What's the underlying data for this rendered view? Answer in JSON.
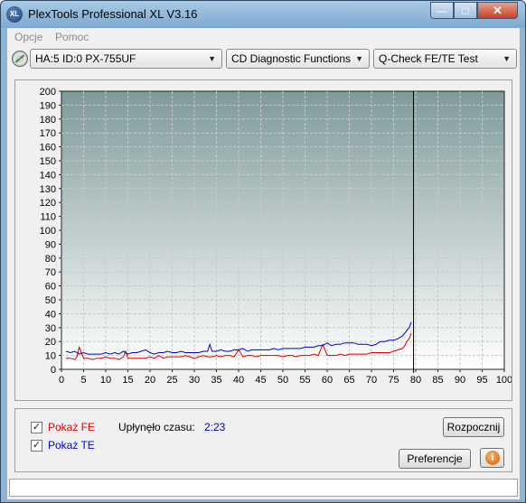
{
  "window": {
    "title": "PlexTools Professional XL V3.16",
    "icon_text": "XL",
    "minimize_symbol": "—",
    "maximize_symbol": "□",
    "close_symbol": "✕"
  },
  "menu": {
    "items": [
      "Opcje",
      "Pomoc"
    ]
  },
  "toolbar": {
    "drive": "HA:5 ID:0  PX-755UF",
    "function": "CD Diagnostic Functions",
    "test": "Q-Check FE/TE Test",
    "arrow_symbol": "▼"
  },
  "chart_data": {
    "type": "line",
    "xlim": [
      0,
      100
    ],
    "ylim": [
      0,
      200
    ],
    "xticks": [
      0,
      5,
      10,
      15,
      20,
      25,
      30,
      35,
      40,
      45,
      50,
      55,
      60,
      65,
      70,
      75,
      80,
      85,
      90,
      95,
      100
    ],
    "yticks": [
      0,
      10,
      20,
      30,
      40,
      50,
      60,
      70,
      80,
      90,
      100,
      110,
      120,
      130,
      140,
      150,
      160,
      170,
      180,
      190,
      200
    ],
    "grid": true,
    "marker_x": 79.5,
    "series": [
      {
        "name": "FE",
        "color": "#e00000",
        "x": [
          1,
          2,
          3,
          3.5,
          4,
          5,
          6,
          7,
          8,
          9,
          10,
          11,
          12,
          13,
          14,
          14.5,
          15,
          16,
          17,
          18,
          19,
          20,
          21,
          22,
          23,
          24,
          25,
          26,
          27,
          28,
          29,
          30,
          31,
          32,
          33,
          34,
          35,
          36,
          37,
          38,
          39,
          40,
          41,
          42,
          43,
          44,
          45,
          46,
          47,
          48,
          49,
          50,
          51,
          52,
          53,
          54,
          55,
          56,
          57,
          58,
          59,
          60,
          61,
          62,
          63,
          64,
          65,
          66,
          67,
          68,
          69,
          70,
          71,
          72,
          73,
          74,
          75,
          76,
          77,
          77.5,
          78,
          78.5,
          79
        ],
        "y": [
          8,
          8,
          7,
          9,
          16,
          8,
          8,
          7,
          8,
          8,
          9,
          8,
          8,
          7,
          9,
          13,
          8,
          8,
          8,
          8,
          8,
          9,
          8,
          10,
          8,
          9,
          9,
          9,
          9,
          10,
          9,
          8,
          9,
          10,
          9,
          9,
          10,
          9,
          10,
          10,
          9,
          14,
          9,
          10,
          10,
          9,
          10,
          10,
          10,
          10,
          10,
          9,
          10,
          10,
          9,
          10,
          10,
          10,
          11,
          10,
          18,
          10,
          10,
          10,
          11,
          10,
          11,
          11,
          11,
          11,
          11,
          12,
          12,
          12,
          12,
          12,
          13,
          14,
          15,
          17,
          20,
          22,
          26
        ]
      },
      {
        "name": "TE",
        "color": "#0000cc",
        "x": [
          1,
          2,
          3,
          4,
          5,
          6,
          7,
          8,
          9,
          10,
          11,
          12,
          13,
          14,
          15,
          16,
          17,
          18,
          19,
          20,
          21,
          22,
          23,
          24,
          25,
          26,
          27,
          28,
          29,
          30,
          31,
          32,
          33,
          33.5,
          34,
          35,
          36,
          37,
          38,
          39,
          40,
          41,
          42,
          43,
          44,
          45,
          46,
          47,
          48,
          49,
          50,
          51,
          52,
          53,
          54,
          55,
          56,
          57,
          58,
          59,
          60,
          61,
          62,
          63,
          64,
          65,
          66,
          67,
          68,
          69,
          70,
          71,
          72,
          73,
          74,
          75,
          76,
          77,
          77.5,
          78,
          78.5,
          79
        ],
        "y": [
          13,
          12,
          13,
          11,
          12,
          11,
          11,
          11,
          11,
          12,
          11,
          12,
          11,
          13,
          11,
          12,
          12,
          13,
          14,
          12,
          11,
          12,
          12,
          13,
          12,
          12,
          13,
          12,
          12,
          12,
          12,
          13,
          13,
          18,
          13,
          13,
          14,
          13,
          13,
          14,
          14,
          15,
          13,
          14,
          14,
          14,
          14,
          14,
          15,
          14,
          15,
          15,
          15,
          15,
          15,
          16,
          16,
          16,
          17,
          17,
          19,
          17,
          18,
          18,
          19,
          19,
          19,
          18,
          18,
          18,
          17,
          18,
          20,
          20,
          21,
          21,
          22,
          24,
          26,
          28,
          30,
          34
        ]
      }
    ]
  },
  "options": {
    "show_fe_label": "Pokaż FE",
    "show_fe_checked": true,
    "show_te_label": "Pokaż TE",
    "show_te_checked": true,
    "check_symbol": "✓",
    "elapsed_label": "Upłynęło czasu:",
    "elapsed_value": "2:23"
  },
  "buttons": {
    "start": "Rozpocznij",
    "preferences": "Preferencje",
    "info_symbol": "i"
  },
  "colors": {
    "fe": "#e00000",
    "te": "#0000cc",
    "plot_bg_top": "#7f9a9a",
    "plot_bg_bottom": "#ffffff"
  }
}
